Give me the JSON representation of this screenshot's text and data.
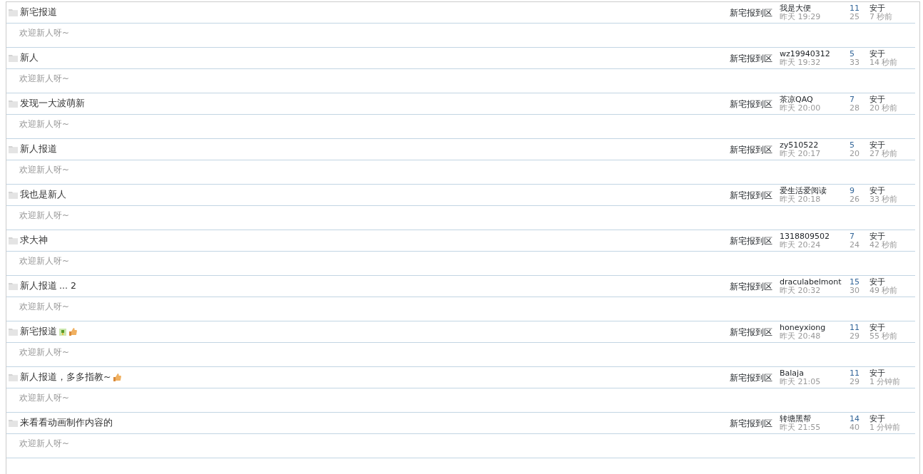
{
  "threads": [
    {
      "title": "新宅报道",
      "excerpt": "欢迎新人呀~",
      "forum": "新宅报到区",
      "author": "我是大便",
      "date": "昨天 19:29",
      "replies": "11",
      "views": "25",
      "last_poster": "安于",
      "last_time": "7 秒前"
    },
    {
      "title": "新人",
      "excerpt": "欢迎新人呀~",
      "forum": "新宅报到区",
      "author": "wz19940312",
      "date": "昨天 19:32",
      "replies": "5",
      "views": "33",
      "last_poster": "安于",
      "last_time": "14 秒前"
    },
    {
      "title": "发现一大波萌新",
      "excerpt": "欢迎新人呀~",
      "forum": "新宅报到区",
      "author": "茶凉QAQ",
      "date": "昨天 20:00",
      "replies": "7",
      "views": "28",
      "last_poster": "安于",
      "last_time": "20 秒前"
    },
    {
      "title": "新人报道",
      "excerpt": "欢迎新人呀~",
      "forum": "新宅报到区",
      "author": "zy510522",
      "date": "昨天 20:17",
      "replies": "5",
      "views": "20",
      "last_poster": "安于",
      "last_time": "27 秒前"
    },
    {
      "title": "我也是新人",
      "excerpt": "欢迎新人呀~",
      "forum": "新宅报到区",
      "author": "爱生活爱阅读",
      "date": "昨天 20:18",
      "replies": "9",
      "views": "26",
      "last_poster": "安于",
      "last_time": "33 秒前"
    },
    {
      "title": "求大神",
      "excerpt": "欢迎新人呀~",
      "forum": "新宅报到区",
      "author": "1318809502",
      "date": "昨天 20:24",
      "replies": "7",
      "views": "24",
      "last_poster": "安于",
      "last_time": "42 秒前"
    },
    {
      "title": "新人报道",
      "pages": "... 2",
      "excerpt": "欢迎新人呀~",
      "forum": "新宅报到区",
      "author": "draculabelmont",
      "date": "昨天 20:32",
      "replies": "15",
      "views": "30",
      "last_poster": "安于",
      "last_time": "49 秒前"
    },
    {
      "title": "新宅报道",
      "icons": [
        {
          "kind": "image"
        },
        {
          "kind": "thumb"
        }
      ],
      "excerpt": "欢迎新人呀~",
      "forum": "新宅报到区",
      "author": "honeyxiong",
      "date": "昨天 20:48",
      "replies": "11",
      "views": "29",
      "last_poster": "安于",
      "last_time": "55 秒前"
    },
    {
      "title": "新人报道，多多指教~",
      "icons": [
        {
          "kind": "thumb"
        }
      ],
      "excerpt": "欢迎新人呀~",
      "forum": "新宅报到区",
      "author": "Balaja",
      "date": "昨天 21:05",
      "replies": "11",
      "views": "29",
      "last_poster": "安于",
      "last_time": "1 分钟前"
    },
    {
      "title": "来看看动画制作内容的",
      "excerpt": "欢迎新人呀~",
      "forum": "新宅报到区",
      "author": "转塘黑帮",
      "date": "昨天 21:55",
      "replies": "14",
      "views": "40",
      "last_poster": "安于",
      "last_time": "1 分钟前"
    }
  ]
}
